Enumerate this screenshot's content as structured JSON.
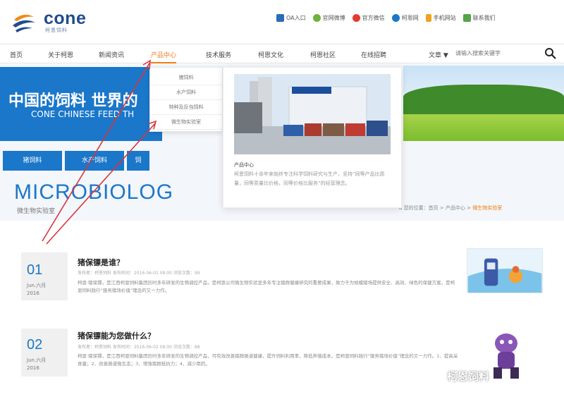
{
  "header": {
    "logo_text": "cone",
    "logo_sub": "柯恩饲料",
    "links": [
      {
        "label": "OA入口",
        "color": "#2a6db5"
      },
      {
        "label": "官网微博",
        "color": "#6cb33f"
      },
      {
        "label": "官方微信",
        "color": "#e53b2f"
      },
      {
        "label": "柯恩网",
        "color": "#1b77c9"
      },
      {
        "label": "手机网站",
        "color": "#f2a21d"
      },
      {
        "label": "联系我们",
        "color": "#56a34a"
      }
    ]
  },
  "nav": {
    "items": [
      "首页",
      "关于柯恩",
      "新闻资讯",
      "产品中心",
      "技术服务",
      "柯恩文化",
      "柯恩社区",
      "在线招聘"
    ],
    "active_index": 3,
    "language": "文章 ▼",
    "search_placeholder": "请输入搜索关键字"
  },
  "banner": {
    "headline_cn": "中国的饲料 世界的",
    "headline_en": "CONE CHINESE FEED TH",
    "buttons": [
      "猪饲料",
      "水产饲料",
      "饲"
    ],
    "section_title": "MICROBIOLOG",
    "section_subtitle": "微生物实验室",
    "breadcrumb_prefix": "您的位置：首页 > 产品中心 >",
    "breadcrumb_current": "微生物实验室"
  },
  "dropdown": {
    "items": [
      "猪饲料",
      "水产饲料",
      "特种及反刍饲料",
      "微生物实验室"
    ]
  },
  "popup": {
    "caption": "产品中心",
    "text": "柯恩饲料十余年来始终专注科学饲料研究与生产，坚持“同等产品比质量，同等质量比价格，同等价格比服务”的经营理念。"
  },
  "articles": [
    {
      "day": "01",
      "month": "Jun.六月",
      "year": "2016",
      "title": "猪保镖是谁？",
      "meta": "发布者：柯恩饲料    发布时间：2016-06-01 08:00    浏览次数：99",
      "body": "柯恩·猪保镖，是江西柯恩饲料集团历时多年研发的生物调控产品，是柯恩公司微生物实验室多年专注猪群健康研究的重要成果，致力于为规模猪场提供安全、高效、绿色的保健方案，是柯恩饲料践行“服务猪场价值”理念的又一力作。"
    },
    {
      "day": "02",
      "month": "Jun.六月",
      "year": "2016",
      "title": "猪保镖能为您做什么？",
      "meta": "发布者：柯恩饲料    发布时间：2016-06-02 08:00    浏览次数：88",
      "body": "柯恩·猪保镖，是江西柯恩饲料集团历时多年研发的生物调控产品，可有效改善猪群肠道健康，提升饲料利用率，降低养殖成本，是柯恩饲料践行“服务猪场价值”理念的又一力作。1、提高采食量；2、改善肠道微生态；3、增强猪群抵抗力；4、减少用药。"
    }
  ],
  "watermark": "柯恩饲料",
  "colors": {
    "brand_blue": "#1b77c9",
    "accent_orange": "#f07b12",
    "arrow_red": "#d9363e"
  }
}
